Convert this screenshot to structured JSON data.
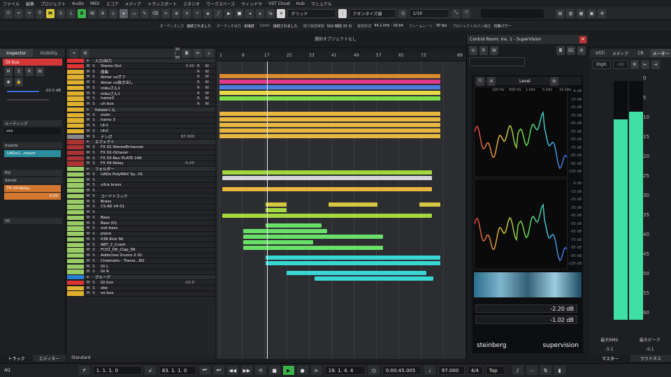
{
  "menu": [
    "ファイル",
    "編集",
    "プロジェクト",
    "Audio",
    "MIDI",
    "スコア",
    "メディア",
    "トランスポート",
    "スタジオ",
    "ワークスペース",
    "ウィンドウ",
    "VST Cloud",
    "Hub",
    "マニュアル"
  ],
  "toolbar": {
    "buttons": [
      "M",
      "S",
      "L",
      "R",
      "W",
      "A"
    ],
    "snap_label": "グリッド",
    "quantize_label": "クオンタイズ値",
    "quantize_value": "1/16"
  },
  "status": [
    [
      "オーディオ入力",
      "接続されました"
    ],
    [
      "オーディオ出力",
      "未接続"
    ],
    [
      "Contr.",
      "接続されました"
    ],
    [
      "残り録音時間",
      "502 時間 33 分"
    ],
    [
      "録音形式",
      "44.1 kHz - 16 bit"
    ],
    [
      "フレームレート",
      "30 fps"
    ],
    [
      "プロジェクトのパン補正",
      "均等パワー"
    ]
  ],
  "info_line": "選択オブジェクトなし",
  "inspector": {
    "tabs": [
      "Inspector",
      "Visibility"
    ],
    "track": "Gt bus",
    "volume": "-10.0 dB",
    "sections": [
      "ルーティング",
      "Inserts",
      "EQ",
      "Sends",
      "QC"
    ],
    "routing_value": "oke",
    "insert_slot": "UADx1...ressor",
    "send_slot": "FX 04-Relay",
    "send_value": "0.00",
    "bottom_tabs": [
      "トラック",
      "エディター"
    ]
  },
  "tracklist": {
    "count": "38 / 38",
    "footer": "Standard",
    "tracks": [
      {
        "name": "入力/出力",
        "color": "#d33",
        "type": "folder"
      },
      {
        "name": "Stereo Out",
        "color": "#d33",
        "vol": "0.00"
      },
      {
        "name": "原曲",
        "color": "#e0b030"
      },
      {
        "name": "Aimer vo才フ",
        "color": "#e0b030"
      },
      {
        "name": "Aimer vo抜き出し",
        "color": "#e0b030"
      },
      {
        "name": "mikuさん1",
        "color": "#e0b030"
      },
      {
        "name": "mikuさん1",
        "color": "#e0b030"
      },
      {
        "name": "hamo3",
        "color": "#e0b030"
      },
      {
        "name": "uh bus",
        "color": "#e0b030"
      },
      {
        "name": "fukaseくん",
        "color": "#e0b030",
        "type": "folder"
      },
      {
        "name": "mein",
        "color": "#e0b030"
      },
      {
        "name": "hamo 3",
        "color": "#e0b030"
      },
      {
        "name": "Uh1",
        "color": "#e0b030"
      },
      {
        "name": "Uh2",
        "color": "#e0b030"
      },
      {
        "name": "テンポ",
        "color": "#888",
        "vol": "97.000"
      },
      {
        "name": "エフェクト",
        "color": "#a33",
        "type": "folder"
      },
      {
        "name": "FX 01-StereoEnhancer",
        "color": "#a33"
      },
      {
        "name": "FX 02-Octaver",
        "color": "#a33"
      },
      {
        "name": "FX 03-Rev PLATE-140",
        "color": "#a33"
      },
      {
        "name": "FX 04-Relay",
        "color": "#a33",
        "vol": "-5.00"
      },
      {
        "name": "フォルダー",
        "color": "#9c6",
        "type": "folder"
      },
      {
        "name": "UADx PolyMAX Sy...01",
        "color": "#9c6"
      },
      {
        "name": "",
        "color": "#9c6"
      },
      {
        "name": "ultra brass",
        "color": "#9c6"
      },
      {
        "name": "",
        "color": "#9c6"
      },
      {
        "name": "コードトラック",
        "color": "#9c6"
      },
      {
        "name": "Brass",
        "color": "#9c6"
      },
      {
        "name": "CS-80 V4 01",
        "color": "#9c6"
      },
      {
        "name": "",
        "color": "#9c6"
      },
      {
        "name": "Bass",
        "color": "#9c6"
      },
      {
        "name": "Bass (D)",
        "color": "#9c6"
      },
      {
        "name": "sub bass",
        "color": "#9c6"
      },
      {
        "name": "piano",
        "color": "#9c6"
      },
      {
        "name": "038 Kick SK",
        "color": "#9c6"
      },
      {
        "name": "ABT_2_Crash",
        "color": "#9c6"
      },
      {
        "name": "FC01_DK_Clap_SR",
        "color": "#9c6"
      },
      {
        "name": "Addictive Drums 2 01",
        "color": "#9c6"
      },
      {
        "name": "Cinematic - Transi...RD",
        "color": "#9c6"
      },
      {
        "name": "Gt L",
        "color": "#9c6"
      },
      {
        "name": "Gt R",
        "color": "#9c6"
      },
      {
        "name": "グループ",
        "color": "#2a7fd4",
        "type": "folder"
      },
      {
        "name": "Gt bus",
        "color": "#d33",
        "vol": "-10.0"
      },
      {
        "name": "oke",
        "color": "#e0b030"
      },
      {
        "name": "vo bus",
        "color": "#e0b030"
      }
    ]
  },
  "ruler": {
    "bars": [
      "1",
      "9",
      "17",
      "25",
      "33",
      "41",
      "49",
      "57",
      "65",
      "73",
      "89"
    ]
  },
  "control_room": {
    "title": "Control Room: Ins. 1 - SuperVision",
    "module": "Level",
    "freqs": [
      "100 Hz",
      "500 Hz",
      "1 kHz",
      "5 kHz",
      "10 kHz"
    ],
    "db_scale": [
      "-6 dB",
      "-15 dB",
      "-25 dB",
      "-35 dB",
      "-45 dB",
      "-55 dB",
      "-65 dB",
      "-75 dB",
      "-85 dB",
      "-95 dB",
      "-105 dB"
    ],
    "readout_1": "-2.20 dB",
    "readout_2": "-1.02 dB",
    "brand": "steinberg",
    "product": "supervision",
    "qc_label": "QC"
  },
  "meter": {
    "tabs": [
      "VSTi",
      "メディア",
      "CR",
      "メーター"
    ],
    "mode": "Digit.",
    "top_value": "-18.",
    "scale": [
      "0",
      "5",
      "10",
      "15",
      "20",
      "25",
      "30",
      "35",
      "40",
      "45",
      "50",
      "55",
      "60"
    ],
    "rms_label": "最大RMS",
    "rms_value": "-5.1",
    "peak_label": "最大ピーク",
    "peak_value": "-0.1",
    "level_left": 0.84,
    "level_right": 0.87,
    "bottom_tabs": [
      "マスター",
      "ラウドネス"
    ]
  },
  "transport": {
    "left_locator": "1. 1. 1. 0",
    "right_locator": "83. 1. 1. 0",
    "position": "19. 1. 4. 4",
    "time": "0:00:45.005",
    "tempo": "97.000",
    "signature": "4/4",
    "tap": "Tap",
    "aq": "AQ"
  }
}
